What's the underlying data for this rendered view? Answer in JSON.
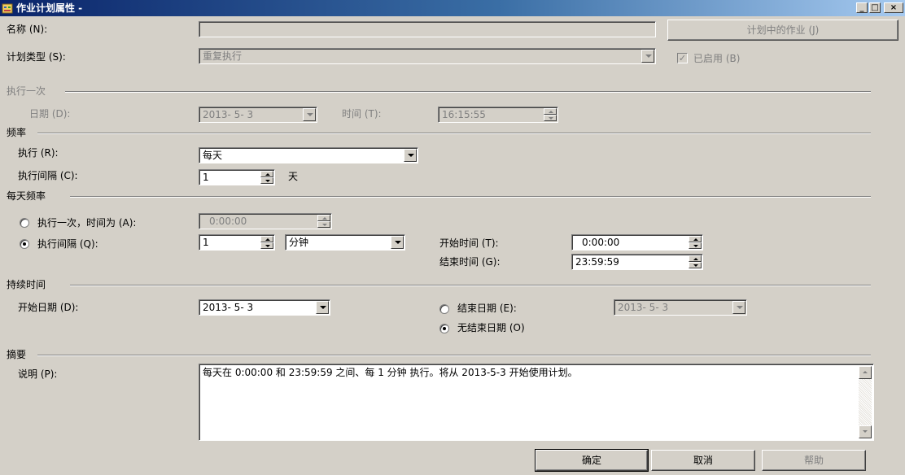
{
  "window": {
    "title": "作业计划属性 -",
    "controls": {
      "minimize": "_",
      "maximize": "□",
      "close": "×"
    }
  },
  "name": {
    "label": "名称 (N):",
    "value": ""
  },
  "scheduled_jobs_button": "计划中的作业 (J)",
  "schedule_type": {
    "label": "计划类型 (S):",
    "value": "重复执行"
  },
  "enabled": {
    "label": "已启用 (B)",
    "checked": true
  },
  "one_time": {
    "group": "执行一次",
    "date_label": "日期 (D):",
    "date_value": "2013- 5- 3",
    "time_label": "时间 (T):",
    "time_value": "16:15:55"
  },
  "frequency": {
    "group": "频率",
    "occurs_label": "执行 (R):",
    "occurs_value": "每天",
    "recurs_label": "执行间隔 (C):",
    "recurs_value": "1",
    "recurs_unit": "天"
  },
  "daily_frequency": {
    "group": "每天频率",
    "once_label": "执行一次，时间为 (A):",
    "once_value": "0:00:00",
    "once_selected": false,
    "every_label": "执行间隔 (Q):",
    "every_value": "1",
    "every_unit": "分钟",
    "every_selected": true,
    "start_label": "开始时间 (T):",
    "start_value": "0:00:00",
    "end_label": "结束时间 (G):",
    "end_value": "23:59:59"
  },
  "duration": {
    "group": "持续时间",
    "start_label": "开始日期 (D):",
    "start_value": "2013- 5- 3",
    "end_date_label": "结束日期 (E):",
    "end_date_value": "2013- 5- 3",
    "end_date_selected": false,
    "no_end_label": "无结束日期 (O)",
    "no_end_selected": true
  },
  "summary": {
    "group": "摘要",
    "desc_label": "说明 (P):",
    "desc_value": "每天在 0:00:00 和 23:59:59 之间、每 1 分钟 执行。将从 2013-5-3 开始使用计划。"
  },
  "buttons": {
    "ok": "确定",
    "cancel": "取消",
    "help": "帮助"
  },
  "colors": {
    "face": "#d4d0c8",
    "title_start": "#0a246a",
    "title_end": "#a6caf0",
    "disabled_text": "#808080"
  }
}
